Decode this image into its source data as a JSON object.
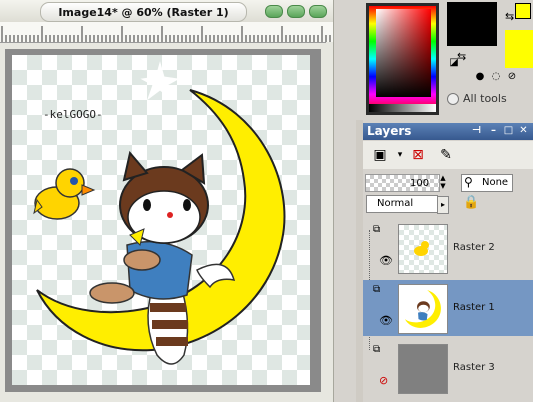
{
  "document": {
    "title": "Image14* @  60% (Raster 1)",
    "watermark": "-kelGOGO-"
  },
  "materials": {
    "foreground_color": "#000000",
    "background_color": "#ffff00",
    "all_tools_label": "All tools"
  },
  "layers_panel": {
    "title": "Layers",
    "opacity": "100",
    "mask_label": "None",
    "blend_mode": "Normal",
    "layers": [
      {
        "name": "Raster 2",
        "selected": false
      },
      {
        "name": "Raster 1",
        "selected": true
      },
      {
        "name": "Raster 3",
        "selected": false
      }
    ]
  },
  "colors": {
    "title_accent": "#37598f",
    "selected_layer": "#7597c3",
    "moon": "#ffee00",
    "shirt": "#3f7fbf"
  }
}
